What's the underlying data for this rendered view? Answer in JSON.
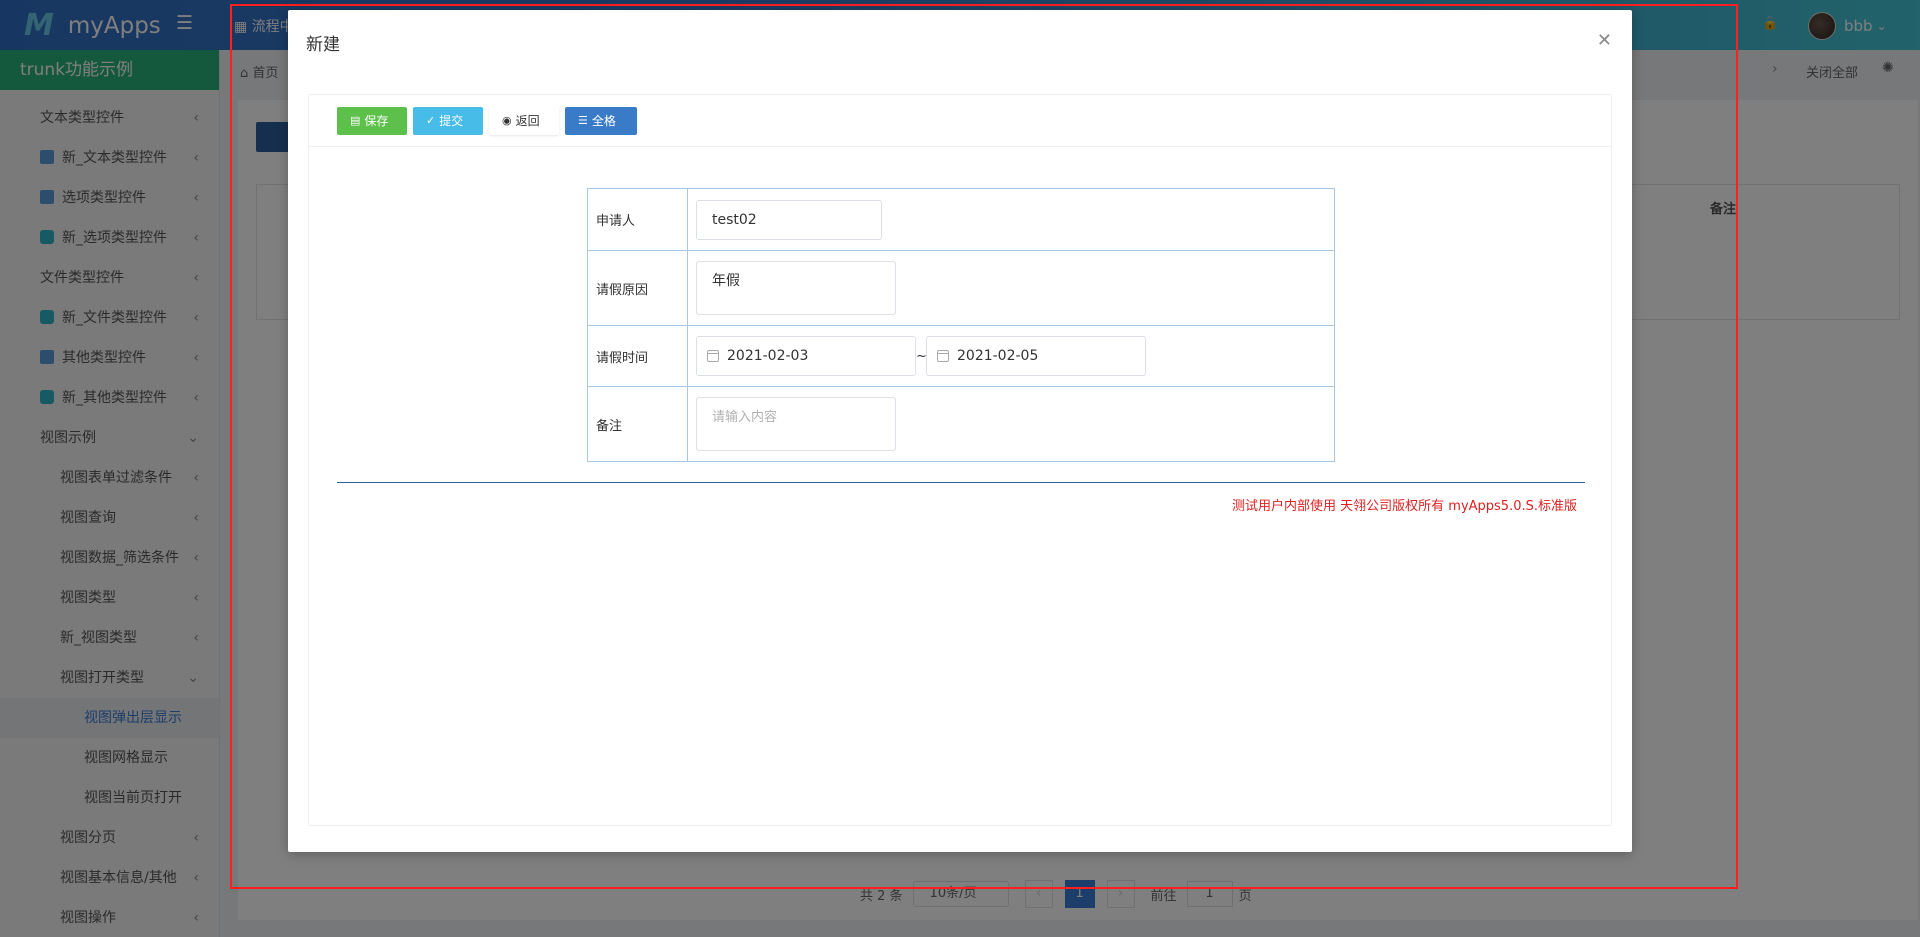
{
  "app": {
    "name": "myApps",
    "top_tab": "流程中",
    "user": "bbb"
  },
  "sidebar": {
    "title": "trunk功能示例",
    "items": [
      {
        "label": "文本类型控件",
        "indent": 0,
        "icon": "",
        "chev": "‹"
      },
      {
        "label": "新_文本类型控件",
        "indent": 0,
        "icon": "doc",
        "chev": "‹"
      },
      {
        "label": "选项类型控件",
        "indent": 0,
        "icon": "doc",
        "chev": "‹"
      },
      {
        "label": "新_选项类型控件",
        "indent": 0,
        "icon": "ring",
        "chev": "‹"
      },
      {
        "label": "文件类型控件",
        "indent": 0,
        "icon": "",
        "chev": "‹"
      },
      {
        "label": "新_文件类型控件",
        "indent": 0,
        "icon": "ring",
        "chev": "‹"
      },
      {
        "label": "其他类型控件",
        "indent": 0,
        "icon": "doc",
        "chev": "‹"
      },
      {
        "label": "新_其他类型控件",
        "indent": 0,
        "icon": "ring",
        "chev": "‹"
      },
      {
        "label": "视图示例",
        "indent": 0,
        "icon": "",
        "chev": "⌄"
      },
      {
        "label": "视图表单过滤条件",
        "indent": 1,
        "icon": "",
        "chev": "‹"
      },
      {
        "label": "视图查询",
        "indent": 1,
        "icon": "",
        "chev": "‹"
      },
      {
        "label": "视图数据_筛选条件",
        "indent": 1,
        "icon": "",
        "chev": "‹"
      },
      {
        "label": "视图类型",
        "indent": 1,
        "icon": "",
        "chev": "‹"
      },
      {
        "label": "新_视图类型",
        "indent": 1,
        "icon": "",
        "chev": "‹"
      },
      {
        "label": "视图打开类型",
        "indent": 1,
        "icon": "",
        "chev": "⌄"
      },
      {
        "label": "视图弹出层显示",
        "indent": 2,
        "icon": "",
        "chev": "",
        "active": true
      },
      {
        "label": "视图网格显示",
        "indent": 2,
        "icon": "",
        "chev": ""
      },
      {
        "label": "视图当前页打开",
        "indent": 2,
        "icon": "",
        "chev": ""
      },
      {
        "label": "视图分页",
        "indent": 1,
        "icon": "",
        "chev": "‹"
      },
      {
        "label": "视图基本信息/其他",
        "indent": 1,
        "icon": "",
        "chev": "‹"
      },
      {
        "label": "视图操作",
        "indent": 1,
        "icon": "",
        "chev": "‹"
      }
    ]
  },
  "breadcrumb": {
    "home": "首页",
    "close_all": "关闭全部"
  },
  "background_table": {
    "header_note": "备注"
  },
  "pager": {
    "total": "共 2 条",
    "page_size": "10条/页",
    "current": "1",
    "goto_label": "前往",
    "goto_value": "1",
    "page_unit": "页"
  },
  "modal": {
    "title": "新建",
    "toolbar": {
      "save": "保存",
      "submit": "提交",
      "back": "返回",
      "grid": "全格"
    },
    "form": {
      "applicant_label": "申请人",
      "applicant_value": "test02",
      "reason_label": "请假原因",
      "reason_value": "年假",
      "time_label": "请假时间",
      "start_date": "2021-02-03",
      "range_sep": "~",
      "end_date": "2021-02-05",
      "remark_label": "备注",
      "remark_placeholder": "请输入内容"
    },
    "copyright": "测试用户内部使用 天翎公司版权所有 myApps5.0.S.标准版"
  },
  "colors": {
    "save": "#5cc04a",
    "submit": "#47bce9",
    "grid": "#3a7bc8",
    "sidebar_title": "#28b07a",
    "highlight": "#ff1f1f"
  }
}
